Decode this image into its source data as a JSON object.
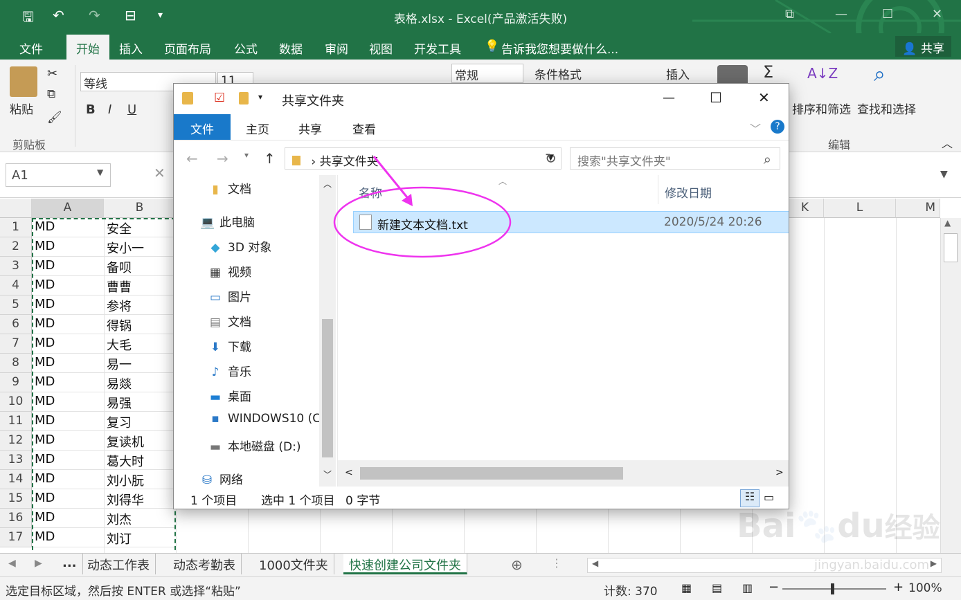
{
  "excel": {
    "title": "表格.xlsx - Excel(产品激活失败)",
    "qat_save": "🖫",
    "qat_undo": "↶",
    "qat_redo": "↷",
    "qat_more": "▾",
    "win_min": "—",
    "win_max": "☐",
    "win_restore": "⧉",
    "win_close": "✕",
    "tabs": [
      "文件",
      "开始",
      "插入",
      "页面布局",
      "公式",
      "数据",
      "审阅",
      "视图",
      "开发工具"
    ],
    "active_tab": "开始",
    "tell_me": "告诉我您想要做什么...",
    "share": "共享",
    "ribbon": {
      "paste": "粘贴",
      "clipboard_group": "剪贴板",
      "font_name": "等线",
      "font_size": "11",
      "bold": "B",
      "italic": "I",
      "underline": "U",
      "number_format": "常规",
      "conditional_format": "条件格式",
      "insert": "插入",
      "sigma": "Σ",
      "sort_filter": "排序和筛选",
      "find_select": "查找和选择",
      "edit_group": "编辑"
    },
    "name_box": "A1",
    "col_headers": [
      "A",
      "B",
      "K",
      "L",
      "M"
    ],
    "rows": [
      {
        "n": "1",
        "a": "MD",
        "b": "安全"
      },
      {
        "n": "2",
        "a": "MD",
        "b": "安小一"
      },
      {
        "n": "3",
        "a": "MD",
        "b": "备呗"
      },
      {
        "n": "4",
        "a": "MD",
        "b": "曹曹"
      },
      {
        "n": "5",
        "a": "MD",
        "b": "参将"
      },
      {
        "n": "6",
        "a": "MD",
        "b": "得锅"
      },
      {
        "n": "7",
        "a": "MD",
        "b": "大毛"
      },
      {
        "n": "8",
        "a": "MD",
        "b": "易一"
      },
      {
        "n": "9",
        "a": "MD",
        "b": "易燚"
      },
      {
        "n": "10",
        "a": "MD",
        "b": "易强"
      },
      {
        "n": "11",
        "a": "MD",
        "b": "复习"
      },
      {
        "n": "12",
        "a": "MD",
        "b": "复读机"
      },
      {
        "n": "13",
        "a": "MD",
        "b": "葛大时"
      },
      {
        "n": "14",
        "a": "MD",
        "b": "刘小朊"
      },
      {
        "n": "15",
        "a": "MD",
        "b": "刘得华"
      },
      {
        "n": "16",
        "a": "MD",
        "b": "刘杰"
      },
      {
        "n": "17",
        "a": "MD",
        "b": "刘订"
      }
    ],
    "sheet_tabs": [
      "...",
      "动态工作表",
      "动态考勤表",
      "1000文件夹",
      "快速创建公司文件夹"
    ],
    "active_sheet": "快速创建公司文件夹",
    "status_msg": "选定目标区域，然后按 ENTER 或选择“粘贴”",
    "count": "计数: 370",
    "zoom": "100%"
  },
  "explorer": {
    "title": "共享文件夹",
    "tabs": [
      "文件",
      "主页",
      "共享",
      "查看"
    ],
    "address": "共享文件夹",
    "search_placeholder": "搜索\"共享文件夹\"",
    "nav": [
      {
        "label": "文档",
        "icon": "folder-icon"
      },
      {
        "label": "此电脑",
        "icon": "computer-icon"
      },
      {
        "label": "3D 对象",
        "icon": "cube-icon"
      },
      {
        "label": "视频",
        "icon": "video-icon"
      },
      {
        "label": "图片",
        "icon": "picture-icon"
      },
      {
        "label": "文档",
        "icon": "document-icon"
      },
      {
        "label": "下载",
        "icon": "download-icon"
      },
      {
        "label": "音乐",
        "icon": "music-icon"
      },
      {
        "label": "桌面",
        "icon": "desktop-icon"
      },
      {
        "label": "WINDOWS10 (C",
        "icon": "drive-icon"
      },
      {
        "label": "本地磁盘 (D:)",
        "icon": "disk-icon"
      },
      {
        "label": "网络",
        "icon": "network-icon"
      }
    ],
    "col_name": "名称",
    "col_date": "修改日期",
    "files": [
      {
        "name": "新建文本文档.txt",
        "date": "2020/5/24 20:26"
      }
    ],
    "status_count": "1 个项目",
    "status_selected": "选中 1 个项目",
    "status_size": "0 字节"
  },
  "watermark": {
    "brand": "Bai",
    "brand2": "du",
    "cn": "经验",
    "url": "jingyan.baidu.com"
  },
  "colors": {
    "excel_green": "#217346",
    "explorer_blue": "#1979ca",
    "selection": "#cce8ff",
    "annotation": "#ee33ee"
  }
}
